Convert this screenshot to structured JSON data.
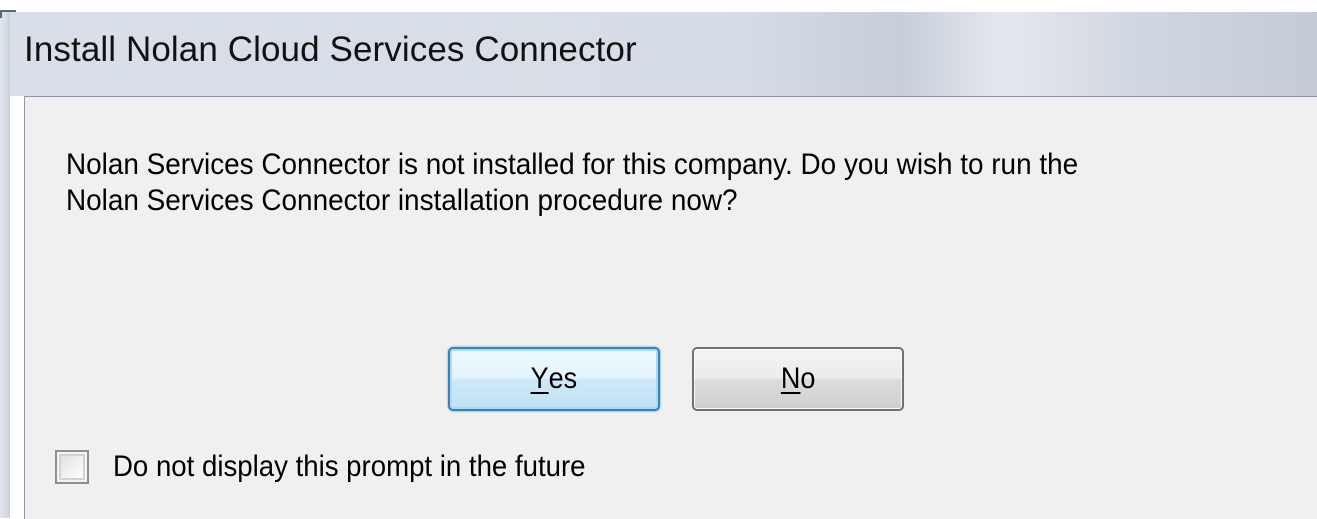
{
  "window": {
    "title": "Install Nolan Cloud Services Connector"
  },
  "dialog": {
    "message": "Nolan Services Connector is not installed for this company. Do you wish to run the\nNolan Services Connector installation procedure now?",
    "buttons": {
      "yes": {
        "mnemonic": "Y",
        "rest": "es",
        "is_default": true
      },
      "no": {
        "mnemonic": "N",
        "rest": "o",
        "is_default": false
      }
    },
    "checkbox": {
      "label": "Do not display this prompt in the future",
      "checked": false
    }
  }
}
